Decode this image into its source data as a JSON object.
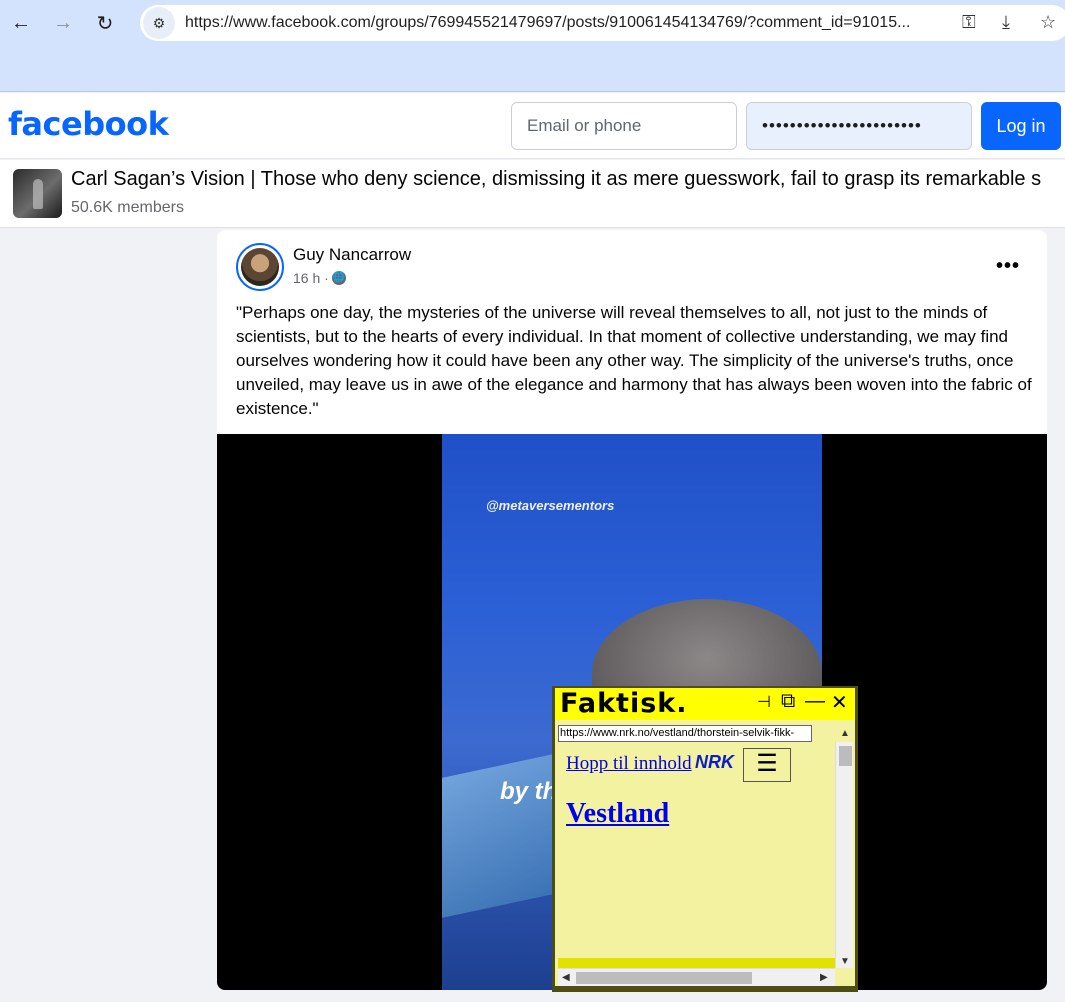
{
  "browser": {
    "back_icon": "←",
    "forward_icon": "→",
    "reload_icon": "↻",
    "site_info_icon": "⚙",
    "url_prefix": "https://",
    "url_host": "www.facebook.com",
    "url_path": "/groups/769945521479697/posts/910061454134769/?comment_id=91015...",
    "key_icon": "⚿",
    "install_icon": "⤓",
    "star_icon": "☆"
  },
  "fb_header": {
    "logo": "facebook",
    "email_placeholder": "Email or phone",
    "password_value": "•••••••••••••••••••••••",
    "login_label": "Log in"
  },
  "group": {
    "title": "Carl Sagan’s Vision | Those who deny science, dismissing it as mere guesswork, fail to grasp its remarkable s",
    "members": "50.6K members"
  },
  "post": {
    "author": "Guy Nancarrow",
    "time": "16 h ·",
    "globe_icon": "🌐",
    "more_icon": "•••",
    "text": "\"Perhaps one day, the mysteries of the universe will reveal themselves to all, not just to the minds of scientists, but to the hearts of every individual. In that moment of collective understanding, we may find ourselves wondering how it could have been any other way. The simplicity of the universe's truths, once unveiled, may leave us in awe of the elegance and harmony that has always been woven into the fabric of existence.\"",
    "video_watermark": "@metaversementors",
    "video_caption": "by the laws of Science?"
  },
  "faktisk": {
    "logo": "Faktisk.",
    "ctrl_pin": "⊣",
    "ctrl_copy": "⧉",
    "ctrl_min": "—",
    "ctrl_close": "✕",
    "url": "https://www.nrk.no/vestland/thorstein-selvik-fikk-",
    "skip_link": "Hopp til innhold",
    "nrk_logo": "NRK",
    "menu_icon": "☰",
    "heading": "Vestland",
    "arrow_up": "▲",
    "arrow_down": "▼",
    "arrow_left": "◀",
    "arrow_right": "▶"
  }
}
